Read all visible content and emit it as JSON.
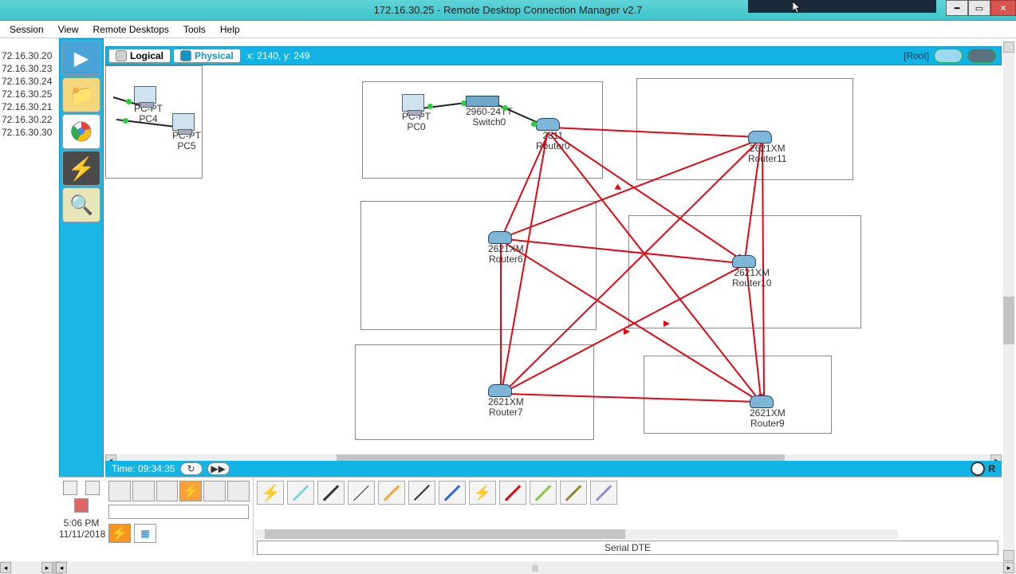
{
  "window": {
    "title": "172.16.30.25 - Remote Desktop Connection Manager v2.7"
  },
  "menu": {
    "items": [
      "Session",
      "View",
      "Remote Desktops",
      "Tools",
      "Help"
    ]
  },
  "ip_list": [
    "72.16.30.20",
    "72.16.30.23",
    "72.16.30.24",
    "72.16.30.25",
    "72.16.30.21",
    "72.16.30.22",
    "72.16.30.30"
  ],
  "viewbar": {
    "logical": "Logical",
    "physical": "Physical",
    "coords": "x: 2140, y: 249",
    "root": "[Root]"
  },
  "time": {
    "label": "Time: 09:34:35",
    "rlabel": "R"
  },
  "devices": {
    "pc4": {
      "line1": "PC-PT",
      "line2": "PC4"
    },
    "pc5": {
      "line1": "PC-PT",
      "line2": "PC5"
    },
    "pc0": {
      "line1": "PC-PT",
      "line2": "PC0"
    },
    "sw0": {
      "line1": "2960-24TT",
      "line2": "Switch0"
    },
    "r0": {
      "line1": "2811",
      "line2": "Router0"
    },
    "r11": {
      "line1": "2621XM",
      "line2": "Router11"
    },
    "r6": {
      "line1": "2621XM",
      "line2": "Router6"
    },
    "r10": {
      "line1": "2621XM",
      "line2": "Router10"
    },
    "r7": {
      "line1": "2621XM",
      "line2": "Router7"
    },
    "r9": {
      "line1": "2621XM",
      "line2": "Router9"
    }
  },
  "status": {
    "cable_name": "Serial DTE"
  },
  "tray": {
    "time": "5:06 PM",
    "date": "11/11/2018"
  }
}
